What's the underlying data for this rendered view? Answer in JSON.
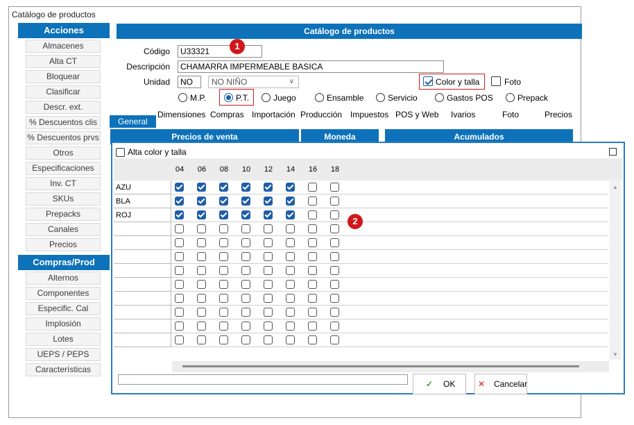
{
  "window": {
    "title": "Catálogo de productos"
  },
  "sidebar": {
    "sections": [
      {
        "title": "Acciones",
        "items": [
          "Almacenes",
          "Alta CT",
          "Bloquear",
          "Clasificar",
          "Descr. ext.",
          "%  Descuentos clis",
          "%  Descuentos prvs",
          "Otros",
          "Especificaciones",
          "Inv. CT",
          "SKUs",
          "Prepacks",
          "Canales",
          "Precios"
        ]
      },
      {
        "title": "Compras/Prod",
        "items": [
          "Alternos",
          "Componentes",
          "Especific. Cal",
          "Implosión",
          "Lotes",
          "UEPS / PEPS",
          "Características"
        ]
      }
    ]
  },
  "form": {
    "header": "Catálogo de productos",
    "codigo_label": "Código",
    "codigo_value": "U33321",
    "descripcion_label": "Descripción",
    "descripcion_value": "CHAMARRA IMPERMEABLE BASICA",
    "unidad_label": "Unidad",
    "unidad_value": "NO",
    "unidad_desc": "NO  NIÑO",
    "color_talla_label": "Color y talla",
    "color_talla_checked": true,
    "foto_label": "Foto",
    "foto_checked": false,
    "types": [
      {
        "label": "M.P.",
        "selected": false
      },
      {
        "label": "P.T.",
        "selected": true
      },
      {
        "label": "Juego",
        "selected": false
      },
      {
        "label": "Ensamble",
        "selected": false
      },
      {
        "label": "Servicio",
        "selected": false
      },
      {
        "label": "Gastos POS",
        "selected": false
      },
      {
        "label": "Prepack",
        "selected": false
      }
    ],
    "tabs": [
      "General",
      "Dimensiones",
      "Compras",
      "Importación",
      "Producción",
      "Impuestos",
      "POS y Web",
      "Ivarios",
      "Foto",
      "Precios"
    ],
    "active_tab": "General",
    "subheaders": [
      "Precios de venta",
      "Moneda",
      "Acumulados"
    ]
  },
  "markers": [
    "1",
    "2"
  ],
  "dialog": {
    "title": "Alta color y talla",
    "sizes": [
      "04",
      "06",
      "08",
      "10",
      "12",
      "14",
      "16",
      "18"
    ],
    "rows": [
      {
        "color": "AZU",
        "checks": [
          true,
          true,
          true,
          true,
          true,
          true,
          false,
          false
        ]
      },
      {
        "color": "BLA",
        "checks": [
          true,
          true,
          true,
          true,
          true,
          true,
          false,
          false
        ]
      },
      {
        "color": "ROJ",
        "checks": [
          true,
          true,
          true,
          true,
          true,
          true,
          false,
          false
        ]
      },
      {
        "color": "",
        "checks": [
          false,
          false,
          false,
          false,
          false,
          false,
          false,
          false
        ]
      },
      {
        "color": "",
        "checks": [
          false,
          false,
          false,
          false,
          false,
          false,
          false,
          false
        ]
      },
      {
        "color": "",
        "checks": [
          false,
          false,
          false,
          false,
          false,
          false,
          false,
          false
        ]
      },
      {
        "color": "",
        "checks": [
          false,
          false,
          false,
          false,
          false,
          false,
          false,
          false
        ]
      },
      {
        "color": "",
        "checks": [
          false,
          false,
          false,
          false,
          false,
          false,
          false,
          false
        ]
      },
      {
        "color": "",
        "checks": [
          false,
          false,
          false,
          false,
          false,
          false,
          false,
          false
        ]
      },
      {
        "color": "",
        "checks": [
          false,
          false,
          false,
          false,
          false,
          false,
          false,
          false
        ]
      },
      {
        "color": "",
        "checks": [
          false,
          false,
          false,
          false,
          false,
          false,
          false,
          false
        ]
      },
      {
        "color": "",
        "checks": [
          false,
          false,
          false,
          false,
          false,
          false,
          false,
          false
        ]
      }
    ],
    "ok_label": "OK",
    "cancel_label": "Cancelar"
  },
  "colors": {
    "accent": "#0d72b9",
    "marker": "#d0181b",
    "check": "#1f5ea8"
  }
}
